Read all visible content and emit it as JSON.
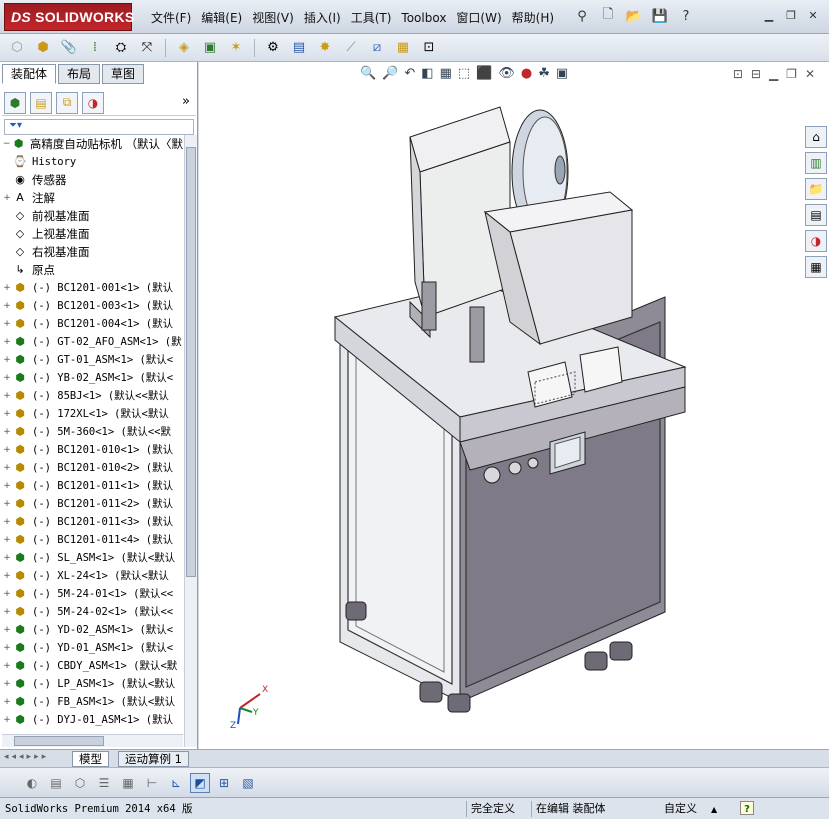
{
  "app": {
    "logo_prefix": "DS",
    "logo_text": "SOLIDWORKS",
    "menus": [
      "文件(F)",
      "编辑(E)",
      "视图(V)",
      "插入(I)",
      "工具(T)",
      "Toolbox",
      "窗口(W)",
      "帮助(H)"
    ]
  },
  "panel": {
    "tabs": [
      "装配体",
      "布局",
      "草图"
    ],
    "active_tab": "装配体",
    "collapse_glyph": "»"
  },
  "tree": {
    "root": "高精度自动贴标机 （默认〈默",
    "items": [
      {
        "label": "History",
        "icon": "history-icon",
        "expand": ""
      },
      {
        "label": "传感器",
        "icon": "sensor-icon",
        "expand": ""
      },
      {
        "label": "注解",
        "icon": "annotation-icon",
        "expand": "+"
      },
      {
        "label": "前视基准面",
        "icon": "plane-icon",
        "expand": ""
      },
      {
        "label": "上视基准面",
        "icon": "plane-icon",
        "expand": ""
      },
      {
        "label": "右视基准面",
        "icon": "plane-icon",
        "expand": ""
      },
      {
        "label": "原点",
        "icon": "origin-icon",
        "expand": ""
      },
      {
        "label": "(-) BC1201-001<1> (默认",
        "icon": "part-icon",
        "expand": "+"
      },
      {
        "label": "(-) BC1201-003<1> (默认",
        "icon": "part-icon",
        "expand": "+"
      },
      {
        "label": "(-) BC1201-004<1> (默认",
        "icon": "part-icon",
        "expand": "+"
      },
      {
        "label": "(-) GT-02_AFO_ASM<1> (默",
        "icon": "assembly-icon",
        "expand": "+"
      },
      {
        "label": "(-) GT-01_ASM<1> (默认<",
        "icon": "assembly-icon",
        "expand": "+"
      },
      {
        "label": "(-) YB-02_ASM<1> (默认<",
        "icon": "assembly-icon",
        "expand": "+"
      },
      {
        "label": "(-) 85BJ<1> (默认<<默认",
        "icon": "part-icon",
        "expand": "+"
      },
      {
        "label": "(-) 172XL<1> (默认<默认",
        "icon": "part-icon",
        "expand": "+"
      },
      {
        "label": "(-) 5M-360<1> (默认<<默",
        "icon": "part-icon",
        "expand": "+"
      },
      {
        "label": "(-) BC1201-010<1> (默认",
        "icon": "part-icon",
        "expand": "+"
      },
      {
        "label": "(-) BC1201-010<2> (默认",
        "icon": "part-icon",
        "expand": "+"
      },
      {
        "label": "(-) BC1201-011<1> (默认",
        "icon": "part-icon",
        "expand": "+"
      },
      {
        "label": "(-) BC1201-011<2> (默认",
        "icon": "part-icon",
        "expand": "+"
      },
      {
        "label": "(-) BC1201-011<3> (默认",
        "icon": "part-icon",
        "expand": "+"
      },
      {
        "label": "(-) BC1201-011<4> (默认",
        "icon": "part-icon",
        "expand": "+"
      },
      {
        "label": "(-) SL_ASM<1> (默认<默认",
        "icon": "assembly-icon",
        "expand": "+"
      },
      {
        "label": "(-) XL-24<1> (默认<默认",
        "icon": "part-icon",
        "expand": "+"
      },
      {
        "label": "(-) 5M-24-01<1> (默认<<",
        "icon": "part-icon",
        "expand": "+"
      },
      {
        "label": "(-) 5M-24-02<1> (默认<<",
        "icon": "part-icon",
        "expand": "+"
      },
      {
        "label": "(-) YD-02_ASM<1> (默认<",
        "icon": "assembly-icon",
        "expand": "+"
      },
      {
        "label": "(-) YD-01_ASM<1> (默认<",
        "icon": "assembly-icon",
        "expand": "+"
      },
      {
        "label": "(-) CBDY_ASM<1> (默认<默",
        "icon": "assembly-icon",
        "expand": "+"
      },
      {
        "label": "(-) LP_ASM<1> (默认<默认",
        "icon": "assembly-icon",
        "expand": "+"
      },
      {
        "label": "(-) FB_ASM<1> (默认<默认",
        "icon": "assembly-icon",
        "expand": "+"
      },
      {
        "label": "(-) DYJ-01_ASM<1> (默认",
        "icon": "assembly-icon",
        "expand": "+"
      }
    ]
  },
  "bottom_tabs": [
    "模型",
    "运动算例 1"
  ],
  "status": {
    "version": "SolidWorks Premium 2014 x64 版",
    "fully_defined": "完全定义",
    "editing": "在编辑 装配体",
    "custom": "自定义",
    "arrow": "▲",
    "help": "?"
  },
  "colors": {
    "brand": "#c2262b",
    "machine_body": "#dcdde3",
    "machine_panel": "#8e8a96",
    "tree_part": "#b88a00",
    "tree_asm": "#1b7a1b"
  }
}
